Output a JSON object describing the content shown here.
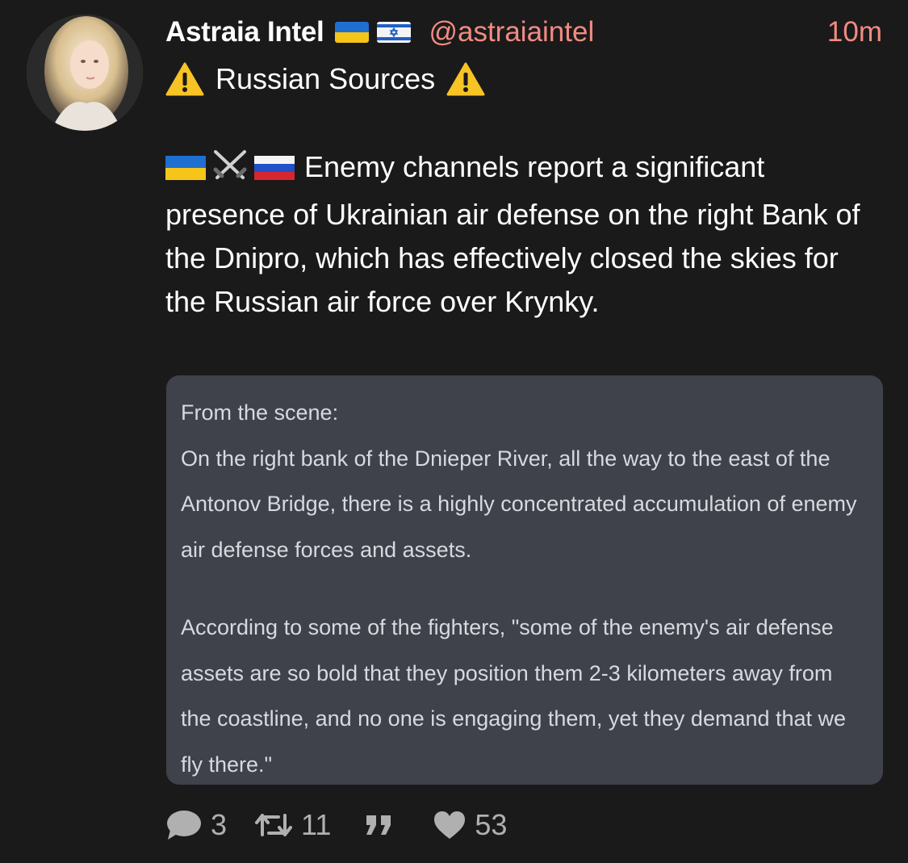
{
  "post": {
    "author_name": "Astraia Intel",
    "handle": "@astraiaintel",
    "timestamp": "10m",
    "headline": "Russian Sources",
    "body": "Enemy channels report a significant presence of Ukrainian air defense on the right Bank of the Dnipro, which has effectively closed the skies for the Russian air force over Krynky."
  },
  "quote_card": {
    "heading": "From the scene:",
    "para1": "On the right bank of the Dnieper River, all the way to the east of the Antonov Bridge, there is a highly concentrated accumulation of enemy air defense forces and assets.",
    "para2": "According to some of the fighters, \"some of the enemy's air defense assets are so bold that they position them 2-3 kilometers away from the coastline, and no one is engaging them, yet they demand that we fly there.\""
  },
  "actions": {
    "replies": "3",
    "reposts": "11",
    "likes": "53"
  },
  "icons": {
    "author_flags": [
      "ukraine-flag-icon",
      "israel-flag-icon"
    ],
    "headline_icons": [
      "warning-icon"
    ],
    "body_flags": [
      "ukraine-flag-icon",
      "crossed-swords-icon",
      "russia-flag-icon"
    ],
    "actions": [
      "reply-icon",
      "repost-icon",
      "quote-icon",
      "like-icon"
    ]
  },
  "colors": {
    "background": "#1a1a1a",
    "handle": "#f28b82",
    "card_bg": "#3f414b",
    "action_icon": "#b0b0b0"
  }
}
